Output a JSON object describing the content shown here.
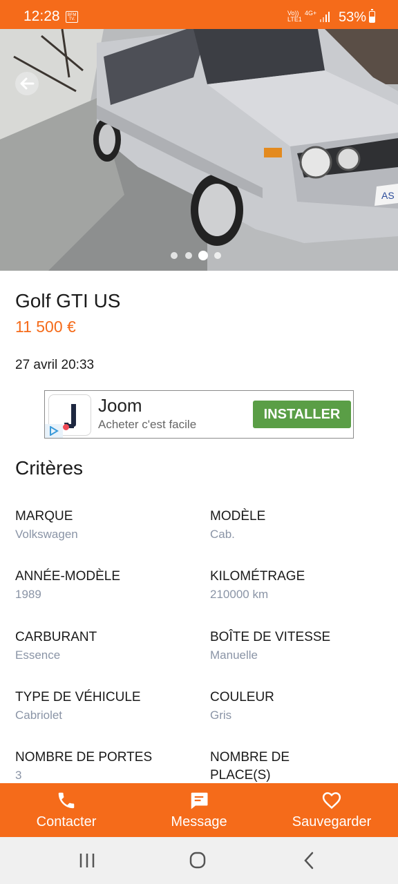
{
  "status_bar": {
    "time": "12:28",
    "notification_text": "BFM TV.",
    "network_line1": "Vo))",
    "network_line2": "LTE1",
    "network_type": "4G+",
    "battery_percent": "53%"
  },
  "gallery": {
    "image_count": 4,
    "active_index": 2
  },
  "listing": {
    "title": "Golf GTI US",
    "price": "11 500 €",
    "date": "27 avril 20:33"
  },
  "ad": {
    "title": "Joom",
    "subtitle": "Acheter c'est facile",
    "button_label": "INSTALLER"
  },
  "criteria": {
    "heading": "Critères",
    "items": [
      {
        "label": "MARQUE",
        "value": "Volkswagen"
      },
      {
        "label": "MODÈLE",
        "value": "Cab."
      },
      {
        "label": "ANNÉE-MODÈLE",
        "value": "1989"
      },
      {
        "label": "KILOMÉTRAGE",
        "value": "210000 km"
      },
      {
        "label": "CARBURANT",
        "value": "Essence"
      },
      {
        "label": "BOÎTE DE VITESSE",
        "value": "Manuelle"
      },
      {
        "label": "TYPE DE VÉHICULE",
        "value": "Cabriolet"
      },
      {
        "label": "COULEUR",
        "value": "Gris"
      },
      {
        "label": "NOMBRE DE PORTES",
        "value": "3"
      },
      {
        "label": "NOMBRE DE PLACE(S)",
        "value": ""
      }
    ]
  },
  "actions": {
    "contact": {
      "label": "Contacter",
      "icon": "phone-icon"
    },
    "message": {
      "label": "Message",
      "icon": "chat-bubble-icon"
    },
    "save": {
      "label": "Sauvegarder",
      "icon": "heart-icon"
    }
  },
  "colors": {
    "brand": "#f56b1a",
    "ad_button": "#5a9e46",
    "value_text": "#8a94a6"
  }
}
